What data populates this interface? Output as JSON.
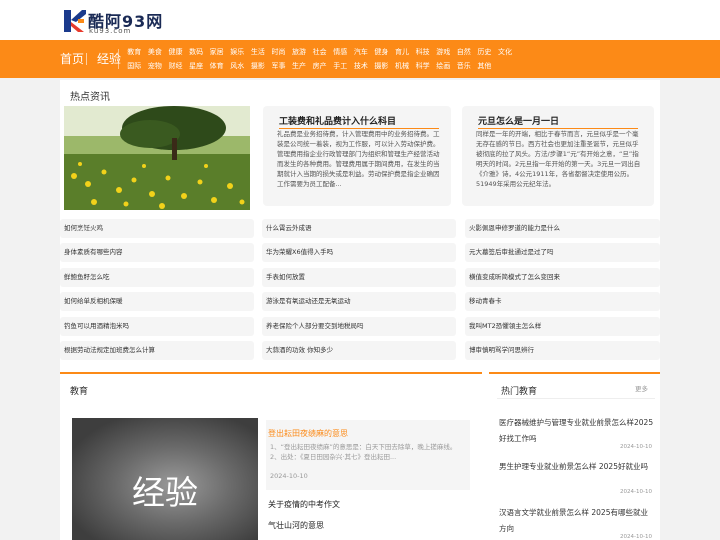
{
  "site": {
    "title": "酷阿93网",
    "subtitle": "ku93.com"
  },
  "colors": {
    "accent": "#fc8a17"
  },
  "nav": {
    "home": "首页",
    "jingyan": "经验",
    "row1": [
      "教育",
      "美食",
      "健康",
      "数码",
      "家居",
      "娱乐",
      "生活",
      "时尚",
      "旅游",
      "社会",
      "情感",
      "汽车",
      "健身",
      "育儿",
      "科技",
      "游戏",
      "自然",
      "历史",
      "文化"
    ],
    "row2": [
      "国际",
      "宠物",
      "财经",
      "星座",
      "体育",
      "风水",
      "摄影",
      "军事",
      "生产",
      "房产",
      "手工",
      "技术",
      "摄影",
      "机械",
      "科学",
      "绘画",
      "音乐",
      "其他"
    ]
  },
  "hot": {
    "title": "热点资讯",
    "card1": {
      "title": "工装费和礼品费计入什么科目",
      "text": "礼品费是业务招待费，计入管理费用中的业务招待费。工装是公司统一着装，视为工作服，可以计入劳动保护费。管理费用指企业行政管理部门为组织和管理生产经营活动而发生的各种费用。管理费用属于期间费用，在发生的当期就计入当期的损失或是利益。劳动保护费是指企业确因工作需要为员工配备..."
    },
    "card2": {
      "title": "元旦怎么是一月一日",
      "text": "同样是一年的开端，相比于春节而言，元旦似乎是一个毫无存在感的节日。西方社会也更加注重圣诞节，元旦似乎被彻底的拉了风头。方法/步骤1“元”有开始之意，“旦”指明天的时间。2元旦指一年开始的第一天。3元旦一词出自《介雅》诗，4公元1911年，各省都督决定使用公历。51949年采用公元纪年法。"
    },
    "list_col1": [
      "如何烹饪火鸡",
      "身体素质有哪些内容",
      "鲜鲍鱼籽怎么吃",
      "如何给单反相机保暖",
      "钓鱼可以用酒精泡米吗",
      "根据劳动法规定加班费怎么计算"
    ],
    "list_col2": [
      "什么霄云外成语",
      "华为荣耀X6值得入手吗",
      "手表如何放置",
      "游泳是有氧运动还是无氧运动",
      "养老保险个人部分要交到地税局吗",
      "大蒜酒的功效 你知多少"
    ],
    "list_col3": [
      "火影佩恩申修罗道的能力是什么",
      "元大墓签后审批通过是过了吗",
      "横值变成昕简模式了怎么变回来",
      "移动青春卡",
      "我叫MT2恐懼領主怎么样",
      "博审慎明骂学问思辨行"
    ]
  },
  "education": {
    "title": "教育",
    "thumb_text": "经验",
    "featured": {
      "title": "登出耘田夜绩麻的意思",
      "excerpt": "1、“登出耘田夜绩麻”的意思是：白天下田去除草，晚上搓麻线。2、出处：《夏日田园杂兴·其七》登出耘田...",
      "date": "2024-10-10"
    },
    "links": [
      "关于疫情的中考作文",
      "气壮山河的意思"
    ]
  },
  "hot_read": {
    "title": "热门教育",
    "more": "更多",
    "items": [
      {
        "title": "医疗器械维护与管理专业就业前景怎么样2025好找工作吗",
        "date": "2024-10-10"
      },
      {
        "title": "男生护理专业就业前景怎么样 2025好就业吗",
        "date": "2024-10-10"
      },
      {
        "title": "汉语言文学就业前景怎么样 2025有哪些就业方向",
        "date": "2024-10-10"
      }
    ]
  }
}
